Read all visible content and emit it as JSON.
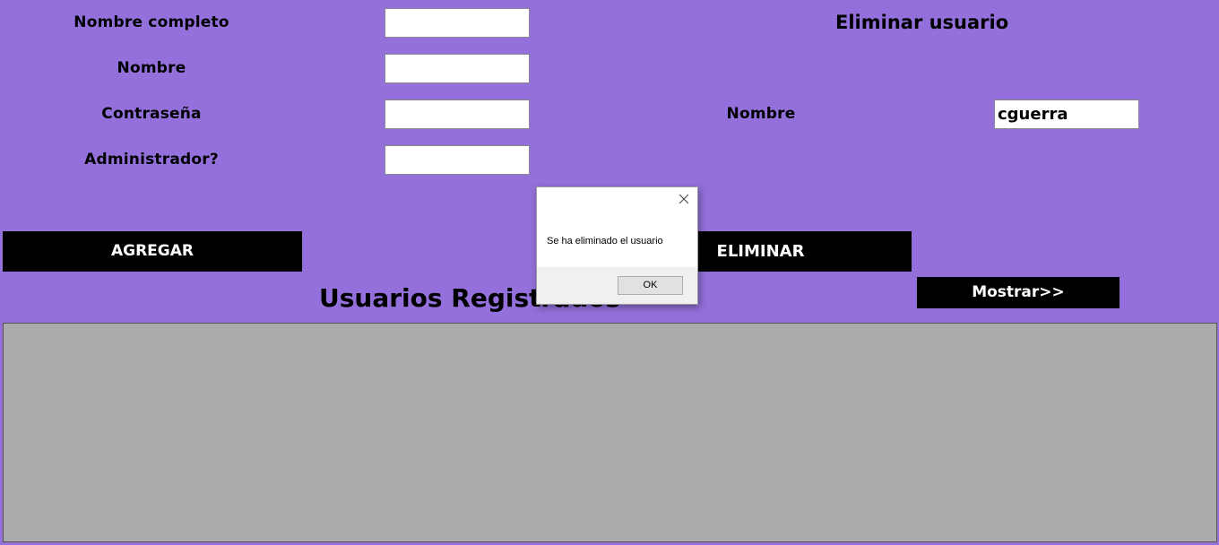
{
  "add_form": {
    "full_name_label": "Nombre completo",
    "username_label": "Nombre",
    "password_label": "Contraseña",
    "admin_label": "Administrador?",
    "full_name_value": "",
    "username_value": "",
    "password_value": "",
    "admin_value": "",
    "add_button": "AGREGAR"
  },
  "delete_form": {
    "title": "Eliminar usuario",
    "username_label": "Nombre",
    "username_value": "cguerra",
    "delete_button": "ELIMINAR"
  },
  "users": {
    "title": "Usuarios Registrados",
    "show_button": "Mostrar>>"
  },
  "dialog": {
    "message": "Se ha eliminado el usuario",
    "ok_button": "OK",
    "close_icon": "close-icon"
  },
  "colors": {
    "background": "#9370db",
    "button": "#000000",
    "button_text": "#ffffff",
    "table_area": "#aaaaaa"
  }
}
